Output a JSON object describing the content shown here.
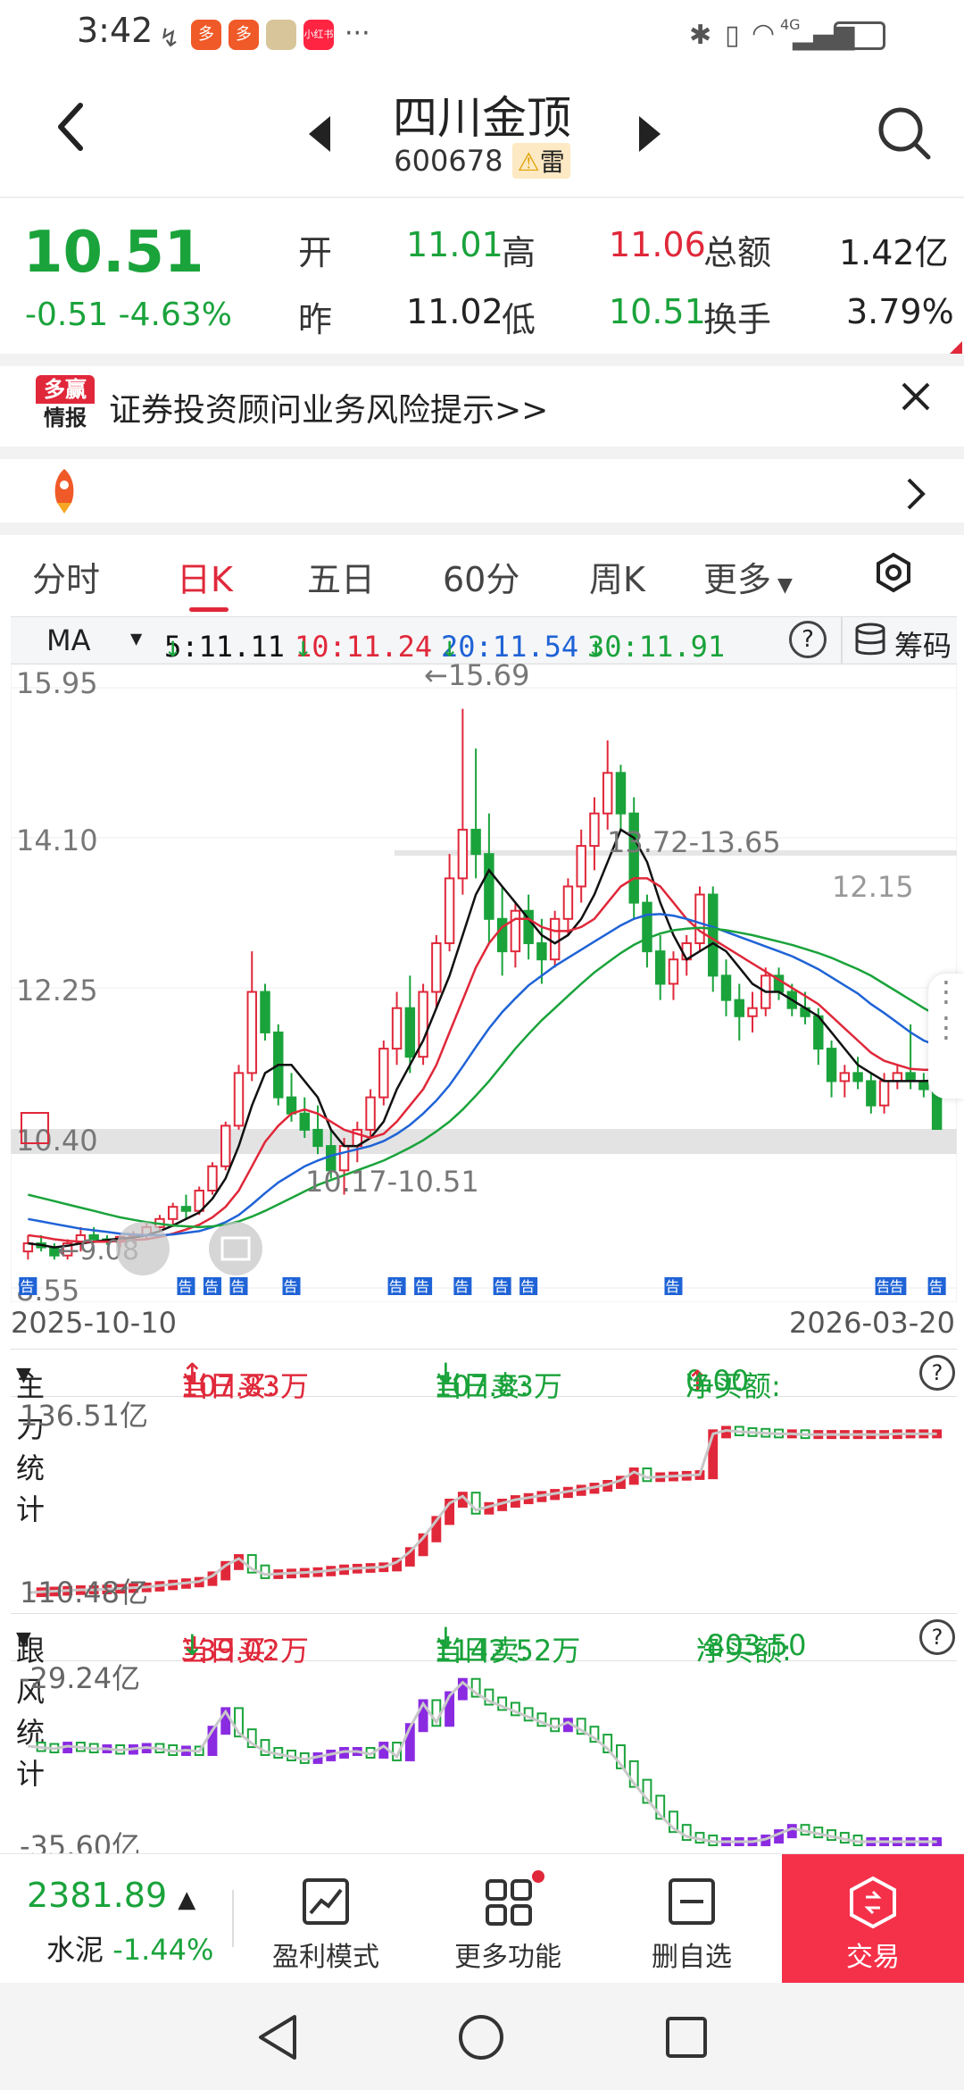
{
  "status": {
    "time": "3:42",
    "app_badges": [
      "多",
      "多",
      "小红书"
    ],
    "net": "4G"
  },
  "header": {
    "title": "四川金顶",
    "code": "600678",
    "badge": "雷"
  },
  "quote": {
    "price": "10.51",
    "change": "-0.51",
    "change_pct": "-4.63%",
    "open_label": "开",
    "open": "11.01",
    "high_label": "高",
    "high": "11.06",
    "amount_label": "总额",
    "amount": "1.42亿",
    "prev_label": "昨",
    "prev": "11.02",
    "low_label": "低",
    "low": "10.51",
    "turnover_label": "换手",
    "turnover": "3.79%"
  },
  "banner1": {
    "logo_top": "多赢",
    "logo_bottom": "情报",
    "text": "证券投资顾问业务风险提示>>"
  },
  "tabs": {
    "items": [
      "分时",
      "日K",
      "五日",
      "60分",
      "周K",
      "更多"
    ],
    "active_index": 1
  },
  "ma": {
    "selector": "MA",
    "ma5": "5:11.11",
    "ma10": "10:11.24",
    "ma20": "20:11.54",
    "ma30": "30:11.91",
    "arrow": "↓",
    "chips_label": "筹码",
    "colors": {
      "ma5": "#111111",
      "ma10": "#e0283a",
      "ma20": "#1f63d6",
      "ma30": "#1aa33b"
    }
  },
  "kchart_labels": {
    "y_ticks": [
      "15.95",
      "14.10",
      "12.25",
      "10.40",
      "8.55"
    ],
    "annot_high": "←15.69",
    "annot_low": "←9.08",
    "annot_zone_mid": "13.72-13.65",
    "annot_zone_low": "10.17-10.51",
    "annot_zone_right": "12.15",
    "announce_mark": "告",
    "x_start": "2025-10-10",
    "x_end": "2026-03-20"
  },
  "chart_data": [
    {
      "type": "candlestick",
      "title": "日K",
      "ylim": [
        8.55,
        15.95
      ],
      "x_range": [
        "2025-10-10",
        "2026-03-20"
      ],
      "candles": [
        [
          9.0,
          9.2,
          8.9,
          9.1
        ],
        [
          9.1,
          9.2,
          9.0,
          9.05
        ],
        [
          9.05,
          9.1,
          8.9,
          8.95
        ],
        [
          8.95,
          9.15,
          8.9,
          9.1
        ],
        [
          9.1,
          9.3,
          9.0,
          9.2
        ],
        [
          9.2,
          9.3,
          9.1,
          9.15
        ],
        [
          9.15,
          9.2,
          9.08,
          9.12
        ],
        [
          9.12,
          9.2,
          9.05,
          9.18
        ],
        [
          9.18,
          9.25,
          9.1,
          9.2
        ],
        [
          9.2,
          9.35,
          9.15,
          9.3
        ],
        [
          9.3,
          9.45,
          9.25,
          9.4
        ],
        [
          9.4,
          9.6,
          9.3,
          9.55
        ],
        [
          9.55,
          9.7,
          9.4,
          9.5
        ],
        [
          9.5,
          9.8,
          9.45,
          9.75
        ],
        [
          9.75,
          10.1,
          9.7,
          10.05
        ],
        [
          10.05,
          10.6,
          10.0,
          10.55
        ],
        [
          10.55,
          11.3,
          10.5,
          11.2
        ],
        [
          11.2,
          12.7,
          11.1,
          12.2
        ],
        [
          12.2,
          12.3,
          11.6,
          11.7
        ],
        [
          11.7,
          11.8,
          10.8,
          10.9
        ],
        [
          10.9,
          11.2,
          10.6,
          10.7
        ],
        [
          10.7,
          10.9,
          10.4,
          10.5
        ],
        [
          10.5,
          10.8,
          10.2,
          10.3
        ],
        [
          10.3,
          10.5,
          9.9,
          10.0
        ],
        [
          10.0,
          10.4,
          9.7,
          10.3
        ],
        [
          10.3,
          10.6,
          10.1,
          10.5
        ],
        [
          10.5,
          11.0,
          10.4,
          10.9
        ],
        [
          10.9,
          11.6,
          10.8,
          11.5
        ],
        [
          11.5,
          12.2,
          11.3,
          12.0
        ],
        [
          12.0,
          12.4,
          11.2,
          11.4
        ],
        [
          11.4,
          12.3,
          11.3,
          12.2
        ],
        [
          12.2,
          12.9,
          12.0,
          12.8
        ],
        [
          12.8,
          13.9,
          12.7,
          13.6
        ],
        [
          13.6,
          15.69,
          13.4,
          14.2
        ],
        [
          14.2,
          15.2,
          13.6,
          13.9
        ],
        [
          13.9,
          14.4,
          12.8,
          13.1
        ],
        [
          13.1,
          13.5,
          12.4,
          12.7
        ],
        [
          12.7,
          13.3,
          12.5,
          13.2
        ],
        [
          13.2,
          13.4,
          12.6,
          12.8
        ],
        [
          12.8,
          13.1,
          12.3,
          12.6
        ],
        [
          12.6,
          13.2,
          12.5,
          13.1
        ],
        [
          13.1,
          13.6,
          12.9,
          13.5
        ],
        [
          13.5,
          14.2,
          13.3,
          14.0
        ],
        [
          14.0,
          14.6,
          13.7,
          14.4
        ],
        [
          14.4,
          15.3,
          14.2,
          14.9
        ],
        [
          14.9,
          15.0,
          14.2,
          14.4
        ],
        [
          14.4,
          14.6,
          13.1,
          13.3
        ],
        [
          13.3,
          13.4,
          12.5,
          12.7
        ],
        [
          12.7,
          12.9,
          12.1,
          12.3
        ],
        [
          12.3,
          12.7,
          12.1,
          12.6
        ],
        [
          12.6,
          12.9,
          12.4,
          12.8
        ],
        [
          12.8,
          13.5,
          12.7,
          13.4
        ],
        [
          13.4,
          13.5,
          12.2,
          12.4
        ],
        [
          12.4,
          12.6,
          11.9,
          12.1
        ],
        [
          12.1,
          12.3,
          11.6,
          11.9
        ],
        [
          11.9,
          12.2,
          11.7,
          12.0
        ],
        [
          12.0,
          12.5,
          11.9,
          12.4
        ],
        [
          12.4,
          12.5,
          12.1,
          12.2
        ],
        [
          12.2,
          12.3,
          11.9,
          12.0
        ],
        [
          12.0,
          12.2,
          11.8,
          11.9
        ],
        [
          11.9,
          12.0,
          11.3,
          11.5
        ],
        [
          11.5,
          11.6,
          10.9,
          11.1
        ],
        [
          11.1,
          11.3,
          10.9,
          11.2
        ],
        [
          11.2,
          11.4,
          11.0,
          11.1
        ],
        [
          11.1,
          11.2,
          10.7,
          10.8
        ],
        [
          10.8,
          11.2,
          10.7,
          11.1
        ],
        [
          11.1,
          11.3,
          11.0,
          11.2
        ],
        [
          11.2,
          11.8,
          11.0,
          11.1
        ],
        [
          11.1,
          11.2,
          10.9,
          11.0
        ],
        [
          11.0,
          11.06,
          10.51,
          10.51
        ]
      ],
      "series": [
        {
          "name": "MA5",
          "values": [
            9.1,
            9.08,
            9.05,
            9.07,
            9.1,
            9.12,
            9.14,
            9.16,
            9.17,
            9.2,
            9.25,
            9.32,
            9.4,
            9.48,
            9.65,
            9.9,
            10.3,
            10.8,
            11.2,
            11.3,
            11.3,
            11.1,
            10.9,
            10.5,
            10.3,
            10.3,
            10.4,
            10.6,
            11.0,
            11.3,
            11.6,
            12.0,
            12.4,
            12.9,
            13.4,
            13.7,
            13.5,
            13.3,
            13.1,
            12.9,
            12.8,
            12.9,
            13.1,
            13.4,
            13.8,
            14.2,
            14.1,
            13.8,
            13.3,
            12.9,
            12.6,
            12.7,
            12.8,
            12.7,
            12.5,
            12.3,
            12.2,
            12.2,
            12.1,
            12.0,
            11.9,
            11.7,
            11.5,
            11.3,
            11.2,
            11.1,
            11.1,
            11.1,
            11.1,
            11.11
          ]
        },
        {
          "name": "MA10",
          "values": [
            9.2,
            9.18,
            9.15,
            9.13,
            9.12,
            9.12,
            9.12,
            9.13,
            9.14,
            9.15,
            9.18,
            9.22,
            9.27,
            9.33,
            9.42,
            9.55,
            9.75,
            10.05,
            10.35,
            10.55,
            10.7,
            10.75,
            10.7,
            10.6,
            10.5,
            10.45,
            10.4,
            10.45,
            10.6,
            10.8,
            11.0,
            11.3,
            11.7,
            12.1,
            12.5,
            12.8,
            13.0,
            13.1,
            13.1,
            13.0,
            12.95,
            12.95,
            13.0,
            13.1,
            13.3,
            13.5,
            13.6,
            13.6,
            13.5,
            13.3,
            13.1,
            12.95,
            12.85,
            12.75,
            12.65,
            12.55,
            12.45,
            12.35,
            12.25,
            12.15,
            12.05,
            11.9,
            11.75,
            11.6,
            11.45,
            11.35,
            11.3,
            11.25,
            11.24,
            11.24
          ]
        },
        {
          "name": "MA20",
          "values": [
            9.4,
            9.37,
            9.34,
            9.31,
            9.28,
            9.26,
            9.24,
            9.22,
            9.21,
            9.2,
            9.2,
            9.21,
            9.23,
            9.25,
            9.3,
            9.36,
            9.45,
            9.58,
            9.72,
            9.85,
            9.95,
            10.05,
            10.12,
            10.18,
            10.22,
            10.26,
            10.3,
            10.36,
            10.45,
            10.56,
            10.7,
            10.86,
            11.05,
            11.28,
            11.52,
            11.75,
            11.95,
            12.12,
            12.28,
            12.4,
            12.52,
            12.62,
            12.72,
            12.82,
            12.92,
            13.02,
            13.1,
            13.15,
            13.16,
            13.14,
            13.1,
            13.05,
            13.0,
            12.94,
            12.88,
            12.82,
            12.76,
            12.7,
            12.64,
            12.56,
            12.48,
            12.38,
            12.28,
            12.18,
            12.05,
            11.94,
            11.82,
            11.7,
            11.6,
            11.54
          ]
        },
        {
          "name": "MA30",
          "values": [
            9.7,
            9.66,
            9.62,
            9.58,
            9.54,
            9.5,
            9.46,
            9.42,
            9.39,
            9.36,
            9.34,
            9.32,
            9.31,
            9.3,
            9.31,
            9.33,
            9.37,
            9.43,
            9.5,
            9.58,
            9.66,
            9.74,
            9.82,
            9.88,
            9.94,
            10.0,
            10.06,
            10.12,
            10.2,
            10.28,
            10.37,
            10.48,
            10.6,
            10.75,
            10.92,
            11.1,
            11.3,
            11.5,
            11.68,
            11.85,
            12.0,
            12.15,
            12.3,
            12.44,
            12.56,
            12.68,
            12.78,
            12.86,
            12.92,
            12.96,
            12.98,
            12.99,
            12.98,
            12.96,
            12.93,
            12.9,
            12.86,
            12.82,
            12.78,
            12.73,
            12.68,
            12.62,
            12.55,
            12.48,
            12.4,
            12.3,
            12.2,
            12.1,
            12.0,
            11.91
          ]
        }
      ]
    },
    {
      "type": "line",
      "title": "主力统计",
      "ylabel_top": "136.51亿",
      "ylabel_bottom": "110.48亿",
      "ylim": [
        110.48,
        136.51
      ],
      "values": [
        110.6,
        110.7,
        110.8,
        110.9,
        111.0,
        111.0,
        111.1,
        111.2,
        111.3,
        111.4,
        111.6,
        111.8,
        112.0,
        112.2,
        113.0,
        114.5,
        115.5,
        114.0,
        113.2,
        113.3,
        113.4,
        113.5,
        113.6,
        113.8,
        114.0,
        114.1,
        114.2,
        114.3,
        115.0,
        116.5,
        118.5,
        121.0,
        123.5,
        124.5,
        122.5,
        123.0,
        123.5,
        124.0,
        124.3,
        124.6,
        124.9,
        125.2,
        125.5,
        125.8,
        126.2,
        126.8,
        128.0,
        127.2,
        127.3,
        127.4,
        127.5,
        127.6,
        133.5,
        134.0,
        133.8,
        133.7,
        133.6,
        133.5,
        133.5,
        133.4,
        133.4,
        133.4,
        133.4,
        133.4,
        133.4,
        133.4,
        133.5,
        133.5,
        133.5,
        133.5
      ],
      "legend": {
        "buy_label": "当日买:",
        "buy": "107.83万",
        "sell_label": "当日卖:",
        "sell": "107.83万",
        "net_label": "净买额:",
        "net": "0.00",
        "more": "净"
      }
    },
    {
      "type": "line",
      "title": "跟风统计",
      "ylabel_top": "-29.24亿",
      "ylabel_bottom": "-35.60亿",
      "ylim": [
        -35.6,
        -29.24
      ],
      "values": [
        -31.9,
        -31.95,
        -32.0,
        -31.9,
        -31.95,
        -32.0,
        -32.0,
        -32.05,
        -32.0,
        -31.95,
        -32.0,
        -32.1,
        -32.05,
        -32.1,
        -31.3,
        -30.6,
        -31.4,
        -31.8,
        -32.1,
        -32.2,
        -32.3,
        -32.4,
        -32.3,
        -32.2,
        -32.1,
        -32.1,
        -32.2,
        -31.9,
        -32.3,
        -31.2,
        -30.3,
        -31.0,
        -30.0,
        -29.5,
        -29.9,
        -30.2,
        -30.4,
        -30.6,
        -30.8,
        -31.0,
        -31.2,
        -31.0,
        -31.3,
        -31.6,
        -32.0,
        -32.6,
        -33.3,
        -33.9,
        -34.5,
        -35.0,
        -35.3,
        -35.4,
        -35.5,
        -35.5,
        -35.5,
        -35.5,
        -35.4,
        -35.2,
        -35.0,
        -35.1,
        -35.2,
        -35.3,
        -35.4,
        -35.5,
        -35.5,
        -35.5,
        -35.5,
        -35.5,
        -35.5,
        -35.5
      ],
      "legend": {
        "buy_label": "当日买:",
        "buy": "339.02万",
        "sell_label": "当日卖:",
        "sell": "1142.52万",
        "net_label": "净买额:",
        "net": "-803.50"
      }
    }
  ],
  "bottom": {
    "index_value": "2381.89",
    "index_arrow": "▲",
    "index_name": "水泥",
    "index_change": "-1.44%",
    "items": [
      {
        "label": "盈利模式",
        "icon": "trend-chart-icon"
      },
      {
        "label": "更多功能",
        "icon": "grid-icon"
      },
      {
        "label": "删自选",
        "icon": "minus-box-icon"
      },
      {
        "label": "交易",
        "icon": "trade-icon"
      }
    ],
    "trade_color": "#f5314a"
  }
}
